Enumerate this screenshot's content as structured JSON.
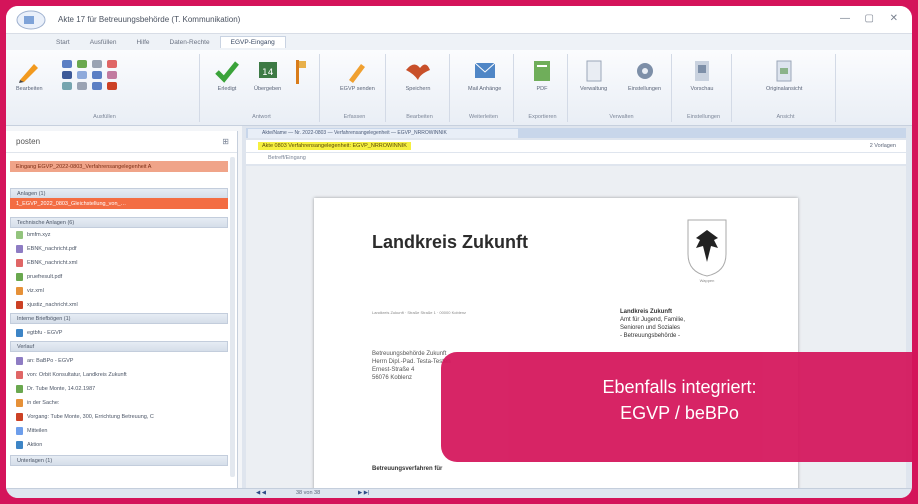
{
  "window": {
    "title": "Akte 17 für Betreuungsbehörde (T. Kommunikation)",
    "controls": [
      "—",
      "▢",
      "✕"
    ]
  },
  "ribbon_tabs": [
    "Start",
    "Ausfüllen",
    "Hilfe",
    "Daten-Rechte",
    "EGVP-Eingang"
  ],
  "ribbon": {
    "edit_label": "Bearbeiten",
    "group1_label": "Ausfüllen",
    "check_label": "Erledigt",
    "transfer_label": "Übergeben",
    "group2_label": "Antwort",
    "egvp_label": "EGVP senden",
    "group3_label": "Erfassen",
    "save_label": "Speichern",
    "group4_label": "Bearbeiten",
    "mail_label": "Mail Anhänge",
    "group5_label": "Weiterleiten",
    "pdf_label": "PDF",
    "group6_label": "Exportieren",
    "misc_label": "Verwaltung",
    "tools_label": "Einstellungen",
    "group7_label": "Verwalten",
    "preview_label": "Vorschau",
    "group8_label": "Einstellungen",
    "last_label": "Originalansicht",
    "group9_label": "Ansicht"
  },
  "left_panel": {
    "header": "posten",
    "rows": [
      {
        "text": "Eingang EGVP_2022-0803_Verfahrensangelegenheit A",
        "style": "orange"
      },
      {
        "text": "Anlagen (1)",
        "style": "section"
      },
      {
        "text": "1_EGVP_2022_0803_Gleichstellung_von_…",
        "style": "red"
      },
      {
        "text": "Technische Anlagen (6)",
        "style": "section"
      },
      {
        "text": "bmfm.xyz",
        "style": "file"
      },
      {
        "text": "EBNK_nachricht.pdf",
        "style": "file"
      },
      {
        "text": "EBNK_nachricht.xml",
        "style": "file"
      },
      {
        "text": "pruefresult.pdf",
        "style": "file"
      },
      {
        "text": "viz.xml",
        "style": "file"
      },
      {
        "text": "xjustiz_nachricht.xml",
        "style": "file"
      },
      {
        "text": "Interne Briefbögen (1)",
        "style": "section"
      },
      {
        "text": "egtbfu - EGVP",
        "style": "file"
      },
      {
        "text": "Verlauf",
        "style": "section"
      },
      {
        "text": "an: BaBPo - EGVP",
        "style": "file"
      },
      {
        "text": "von: Orbit Konsultatur, Landkreis Zukunft",
        "style": "file"
      },
      {
        "text": "Dr. Tube Monte, 14.02.1987",
        "style": "file"
      },
      {
        "text": "in der Sache:",
        "style": "file"
      },
      {
        "text": "Vorgang: Tube Monte, 300, Errichtung Betreuung, C",
        "style": "file"
      },
      {
        "text": "Mitteilen",
        "style": "file"
      },
      {
        "text": "Aktion",
        "style": "file"
      },
      {
        "text": "Unterlagen (1)",
        "style": "section"
      }
    ]
  },
  "document": {
    "tab_label": "Akte/Name — Nr. 2022-0803 — Verfahrensangelegenheit — EGVP_NRROWINNIK",
    "subject": "Akte 0803 Verfahrensangelegenheit: EGVP_NRROWINNIK",
    "subject_right": "2 Vorlagen",
    "sub_line": "Betreff/Eingang",
    "page_title": "Landkreis Zukunft",
    "crest_label": "Wappen",
    "address_line": "Landkreis Zukunft · Straße Straße 1 · 00000 Koblenz",
    "sender_lines": [
      "Landkreis Zukunft",
      "Amt für Jugend, Familie,",
      "Senioren und Soziales",
      "- Betreuungsbehörde -"
    ],
    "recipient_lines": [
      "Betreuungsbehörde Zukunft",
      "Herrn Dipl.-Pad. Testa-Testen",
      "Ernest-Straße 4",
      "56076 Koblenz"
    ],
    "betreff": "Betreuungsverfahren für"
  },
  "statusbar": {
    "prev": "◀ ◀",
    "page": "38 von 38",
    "next": "▶ ▶|"
  },
  "overlay": {
    "line1": "Ebenfalls integriert:",
    "line2": "EGVP / beBPo"
  },
  "colors": {
    "brand": "#d4145a",
    "highlight_yellow": "#f6f040",
    "highlight_red": "#f36d43"
  }
}
